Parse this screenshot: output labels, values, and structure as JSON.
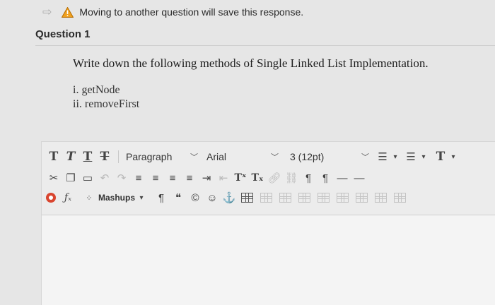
{
  "warning": {
    "text": "Moving to another question will save this response.",
    "icon": "warning-triangle-icon",
    "icon_color": "#f0a01e"
  },
  "question": {
    "title": "Question 1",
    "prompt": "Write down the following methods of Single Linked List Implementation.",
    "items": [
      "i. getNode",
      "ii. removeFirst"
    ]
  },
  "editor": {
    "row1": {
      "block_format": "Paragraph",
      "font_family": "Arial",
      "font_size": "3 (12pt)"
    },
    "row3": {
      "mashups_label": "Mashups"
    }
  }
}
